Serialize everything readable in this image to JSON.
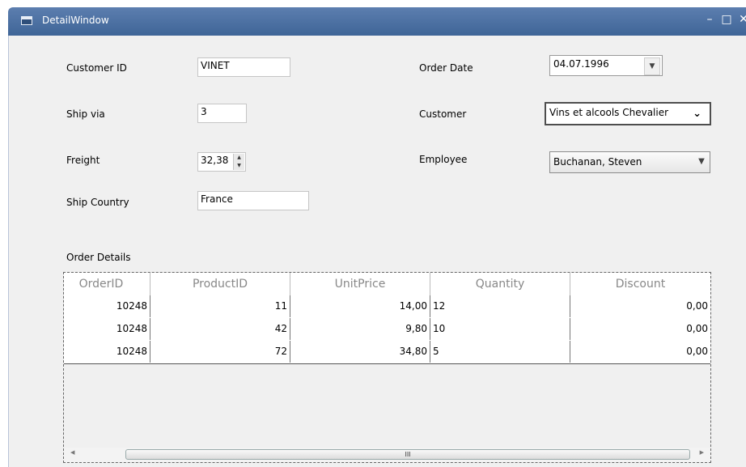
{
  "window": {
    "title": "DetailWindow",
    "min_glyph": "–",
    "max_glyph": "□",
    "close_glyph": "✕"
  },
  "form": {
    "customer_id_label": "Customer ID",
    "customer_id_value": "VINET",
    "ship_via_label": "Ship via",
    "ship_via_value": "3",
    "freight_label": "Freight",
    "freight_value": "32,38",
    "ship_country_label": "Ship Country",
    "ship_country_value": "France",
    "order_date_label": "Order Date",
    "order_date_value": "04.07.1996",
    "customer_label": "Customer",
    "customer_value": "Vins et alcools Chevalier",
    "employee_label": "Employee",
    "employee_value": "Buchanan, Steven"
  },
  "details": {
    "section_label": "Order Details",
    "columns": [
      "OrderID",
      "ProductID",
      "UnitPrice",
      "Quantity",
      "Discount"
    ],
    "rows": [
      [
        "10248",
        "11",
        "14,00",
        "12",
        "0,00"
      ],
      [
        "10248",
        "42",
        "9,80",
        "10",
        "0,00"
      ],
      [
        "10248",
        "72",
        "34,80",
        "5",
        "0,00"
      ]
    ],
    "scroll_thumb_grip": "III"
  }
}
